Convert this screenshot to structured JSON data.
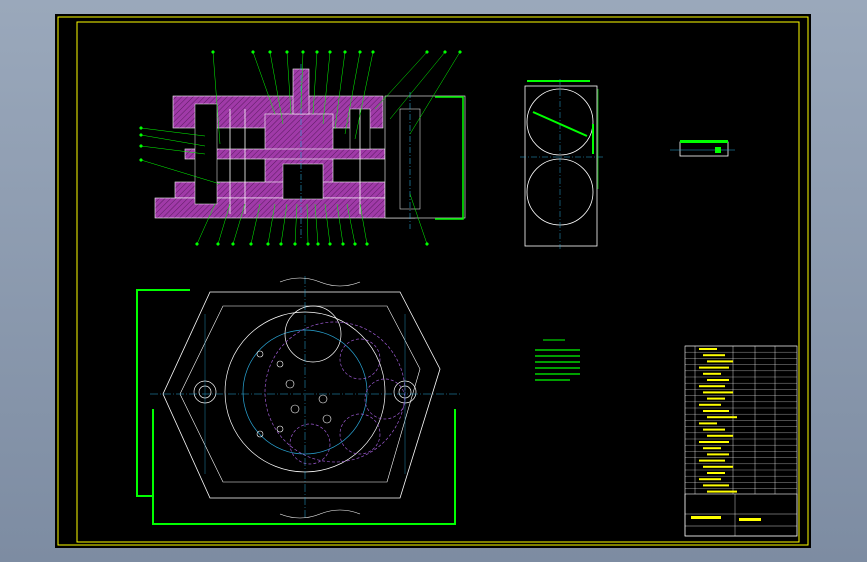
{
  "drawing": {
    "title_block": {
      "label_a": "",
      "label_b": ""
    },
    "colors": {
      "sheet_background": "#000000",
      "frame": "#ffff00",
      "outline": "#ffffff",
      "section_fill": "#a03aa8",
      "hatch": "#7b2d83",
      "centerline": "#2aa7d8",
      "hidden": "#9b59d0",
      "leader": "#00ff00",
      "note_text": "#00ff00"
    },
    "icons": [
      "section-view",
      "plan-view",
      "side-detail",
      "small-detail",
      "parts-list",
      "technical-notes"
    ]
  }
}
